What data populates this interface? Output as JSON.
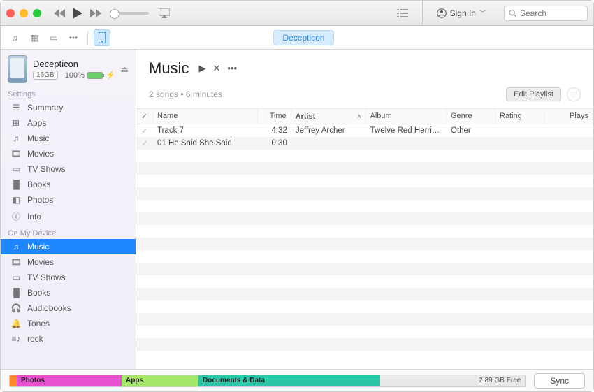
{
  "titlebar": {
    "signin": "Sign In",
    "search_placeholder": "Search"
  },
  "toolbar": {
    "device_pill": "Decepticon"
  },
  "device": {
    "name": "Decepticon",
    "capacity": "16GB",
    "battery_pct": "100%"
  },
  "sidebar": {
    "settings_title": "Settings",
    "settings": [
      {
        "label": "Summary",
        "icon": "summary"
      },
      {
        "label": "Apps",
        "icon": "apps"
      },
      {
        "label": "Music",
        "icon": "music"
      },
      {
        "label": "Movies",
        "icon": "movies"
      },
      {
        "label": "TV Shows",
        "icon": "tv"
      },
      {
        "label": "Books",
        "icon": "books"
      },
      {
        "label": "Photos",
        "icon": "photos"
      },
      {
        "label": "Info",
        "icon": "info"
      }
    ],
    "device_title": "On My Device",
    "on_device": [
      {
        "label": "Music",
        "icon": "music",
        "selected": true
      },
      {
        "label": "Movies",
        "icon": "movies"
      },
      {
        "label": "TV Shows",
        "icon": "tv"
      },
      {
        "label": "Books",
        "icon": "books"
      },
      {
        "label": "Audiobooks",
        "icon": "audiobooks"
      },
      {
        "label": "Tones",
        "icon": "tones"
      },
      {
        "label": "rock",
        "icon": "playlist"
      }
    ]
  },
  "content": {
    "title": "Music",
    "meta": "2 songs • 6 minutes",
    "edit_label": "Edit Playlist",
    "columns": {
      "check": "✓",
      "name": "Name",
      "time": "Time",
      "artist": "Artist",
      "album": "Album",
      "genre": "Genre",
      "rating": "Rating",
      "plays": "Plays"
    },
    "rows": [
      {
        "name": "Track 7",
        "time": "4:32",
        "artist": "Jeffrey Archer",
        "album": "Twelve Red Herri…",
        "genre": "Other",
        "rating": "",
        "plays": ""
      },
      {
        "name": "01 He Said She Said",
        "time": "0:30",
        "artist": "",
        "album": "",
        "genre": "",
        "rating": "",
        "plays": ""
      }
    ]
  },
  "bottombar": {
    "photos": "Photos",
    "apps": "Apps",
    "docs": "Documents & Data",
    "free": "2.89 GB Free",
    "sync": "Sync"
  }
}
